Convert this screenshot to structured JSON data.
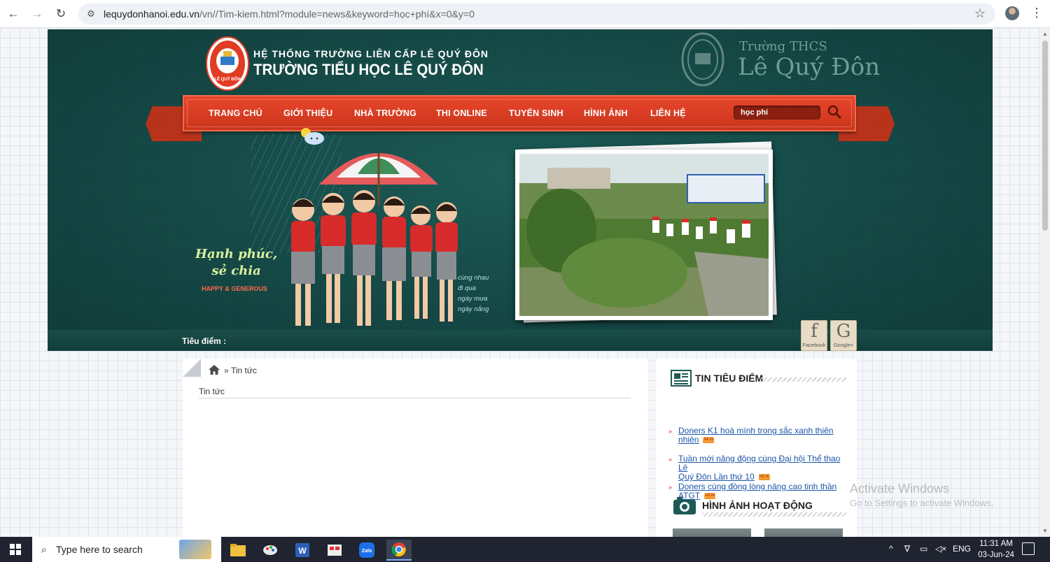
{
  "browser": {
    "url_host": "lequydonhanoi.edu.vn",
    "url_rest": "/vn//Tim-kiem.html?module=news&keyword=học+phí&x=0&y=0",
    "icons": [
      "back-icon",
      "forward-icon",
      "reload-icon",
      "site-settings-icon",
      "bookmark-star-icon",
      "profile-avatar",
      "menu-kebab-icon"
    ]
  },
  "header": {
    "brand_small": "HỆ THỐNG TRƯỜNG LIÊN CẤP LÊ QUÝ ĐÔN",
    "brand_big": "TRƯỜNG TIỂU HỌC LÊ QUÝ ĐÔN",
    "logo_text": "LÊ QUÝ ĐÔN",
    "thcs_small": "Trường THCS",
    "thcs_big": "Lê Quý Đôn"
  },
  "menu": {
    "items": [
      "TRANG CHỦ",
      "GIỚI THIỆU",
      "NHÀ TRƯỜNG",
      "THI ONLINE",
      "TUYỂN SINH",
      "HÌNH ẢNH",
      "LIÊN HỆ"
    ],
    "search_value": "học phí"
  },
  "banner": {
    "slogan_line1": "Hạnh phúc,",
    "slogan_line2": "sẻ chia",
    "slogan_sub": "HAPPY & GENEROUS",
    "side_note_line1": "cùng nhau",
    "side_note_line2": "đi qua",
    "side_note_line3": "ngày mưa",
    "side_note_line4": "ngày nắng",
    "focus_label": "Tiêu điểm :"
  },
  "social": {
    "facebook_glyph": "f",
    "facebook_label": "Facebook",
    "google_glyph": "G",
    "google_label": "Google+"
  },
  "main": {
    "breadcrumb_sep": "»",
    "breadcrumb_item": "Tin tức",
    "section_title": "Tin tức"
  },
  "sidebar": {
    "heading1": "TIN TIÊU ĐIỂM",
    "news": [
      {
        "line1": "Doners K1 hoà mình trong sắc xanh thiên",
        "line2": "nhiên"
      },
      {
        "line1": "Tuần mới năng động cùng Đại hội Thể thao Lê",
        "line2": "Quý Đôn Lần thứ 10"
      },
      {
        "line1": "Doners cùng đồng lòng nâng cao tinh thần",
        "line2": "ATGT"
      }
    ],
    "new_badge": "NEW",
    "heading2": "HÌNH ẢNH HOẠT ĐỘNG"
  },
  "watermark": {
    "line1": "Activate Windows",
    "line2": "Go to Settings to activate Windows."
  },
  "taskbar": {
    "search_placeholder": "Type here to search",
    "language": "ENG",
    "time": "11:31 AM",
    "date": "03-Jun-24"
  },
  "colors": {
    "banner_green": "#154a47",
    "menu_red": "#d83b20",
    "link_blue": "#1a55a8"
  }
}
